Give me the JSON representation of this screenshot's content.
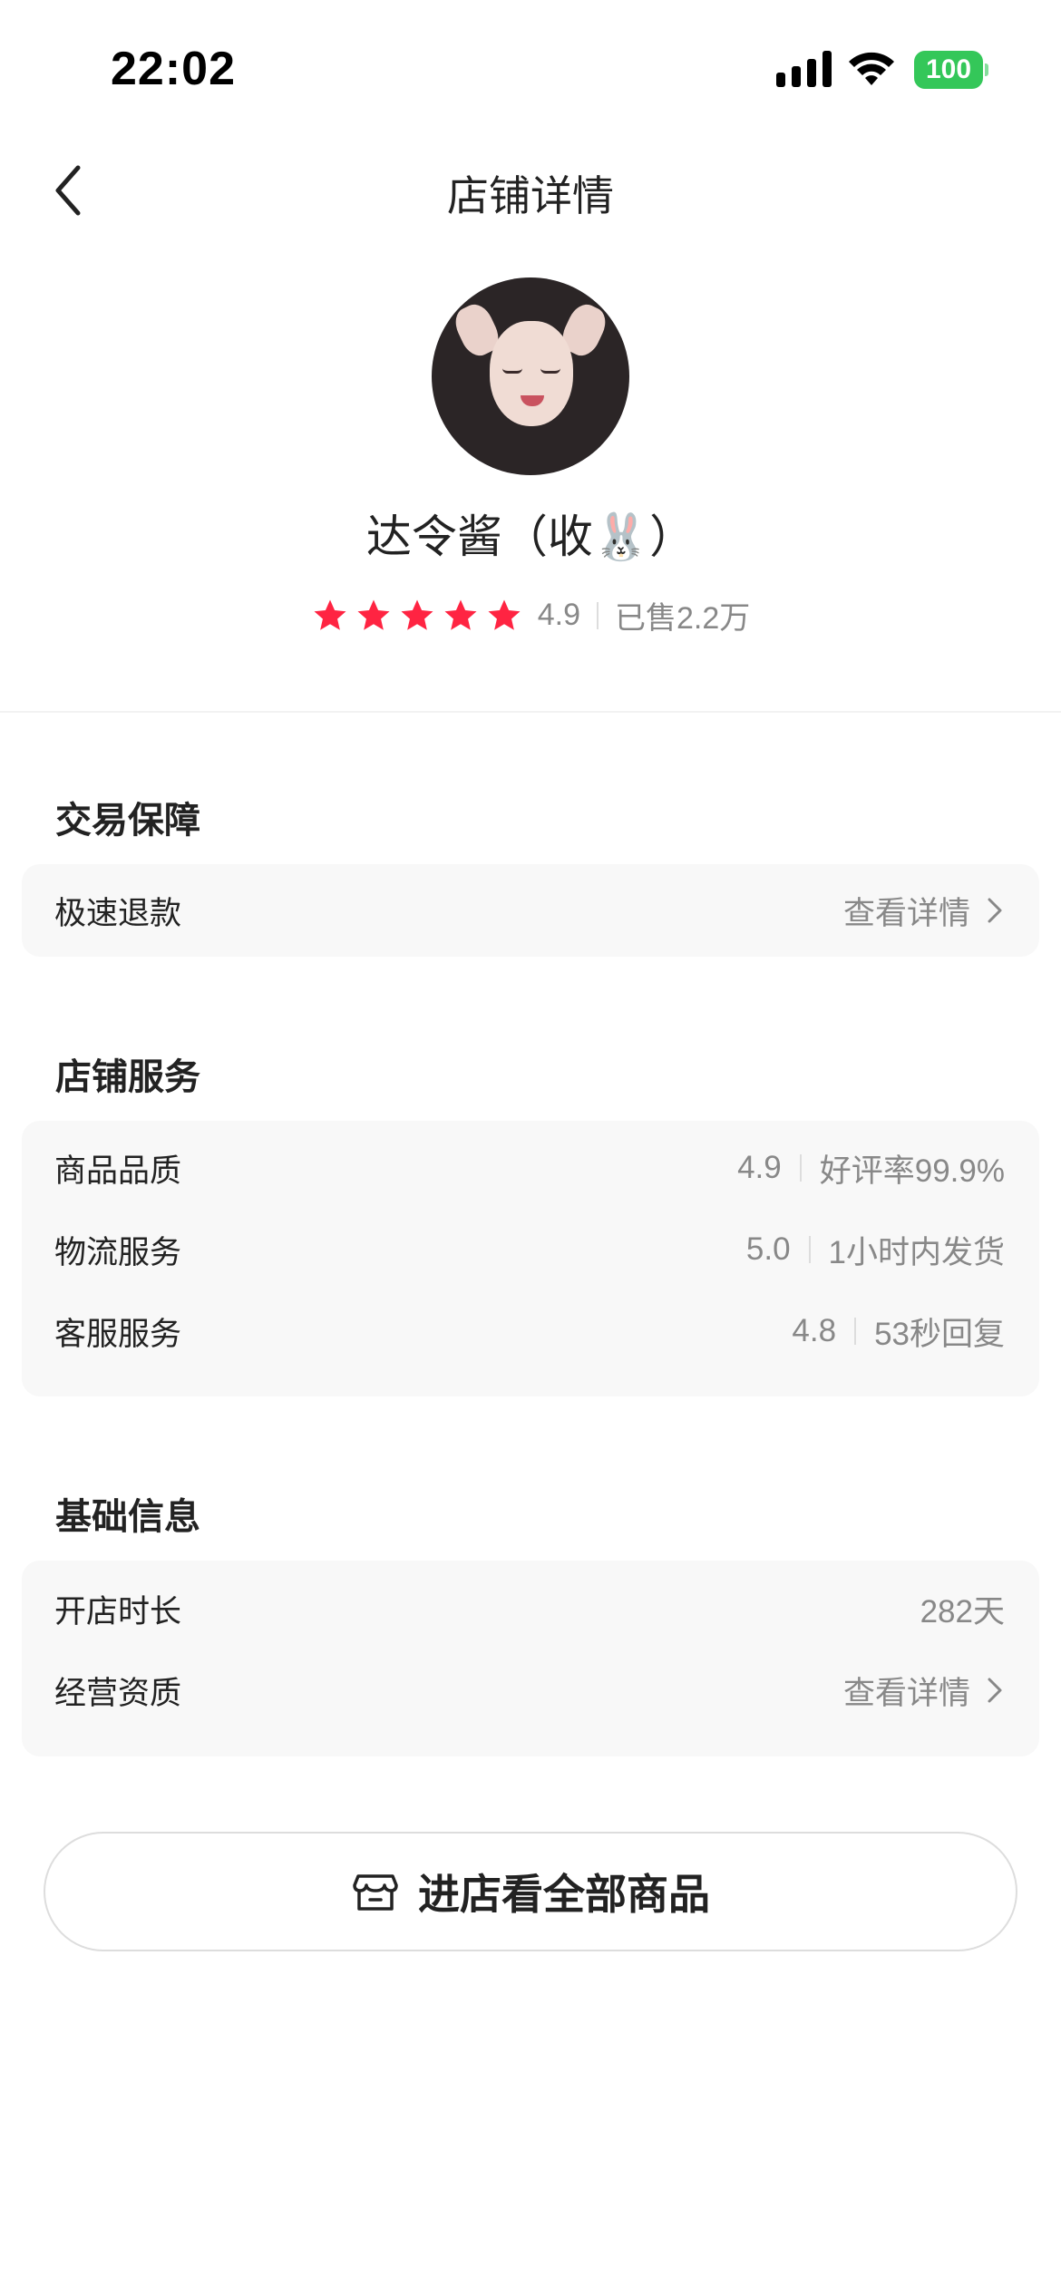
{
  "status_bar": {
    "time": "22:02",
    "battery": "100"
  },
  "nav": {
    "title": "店铺详情"
  },
  "shop": {
    "name": "达令酱（收🐰）",
    "rating": "4.9",
    "sold": "已售2.2万",
    "stars": 5
  },
  "trade_guarantee": {
    "title": "交易保障",
    "row": {
      "label": "极速退款",
      "action": "查看详情"
    }
  },
  "store_service": {
    "title": "店铺服务",
    "rows": [
      {
        "label": "商品品质",
        "score": "4.9",
        "detail": "好评率99.9%"
      },
      {
        "label": "物流服务",
        "score": "5.0",
        "detail": "1小时内发货"
      },
      {
        "label": "客服服务",
        "score": "4.8",
        "detail": "53秒回复"
      }
    ]
  },
  "basic_info": {
    "title": "基础信息",
    "rows": [
      {
        "label": "开店时长",
        "value": "282天"
      },
      {
        "label": "经营资质",
        "action": "查看详情"
      }
    ]
  },
  "enter_button": {
    "label": "进店看全部商品"
  },
  "colors": {
    "star": "#ff2442",
    "battery": "#34c759",
    "card_bg": "#f8f8f8"
  },
  "icons": [
    "back-chevron-icon",
    "star-icon",
    "chevron-right-icon",
    "store-icon",
    "signal-icon",
    "wifi-icon",
    "battery-icon"
  ]
}
